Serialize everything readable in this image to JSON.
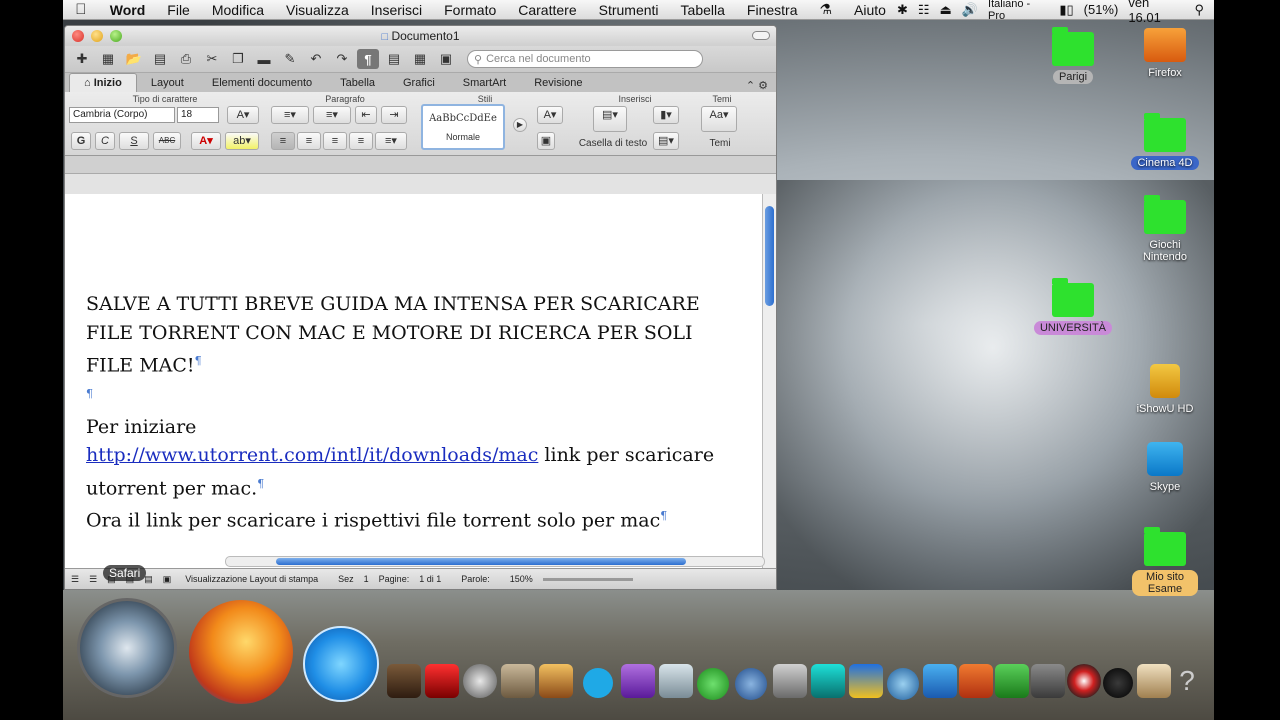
{
  "menubar": {
    "app": "Word",
    "items": [
      "File",
      "Modifica",
      "Visualizza",
      "Inserisci",
      "Formato",
      "Carattere",
      "Strumenti",
      "Tabella",
      "Finestra",
      "Aiuto"
    ],
    "input_source": "Italiano - Pro",
    "battery": "(51%)",
    "clock": "ven 16.01"
  },
  "window": {
    "title": "Documento1",
    "search_placeholder": "Cerca nel documento",
    "tabs": [
      "Inizio",
      "Layout",
      "Elementi documento",
      "Tabella",
      "Grafici",
      "SmartArt",
      "Revisione"
    ],
    "active_tab": "Inizio",
    "ribbon": {
      "font_group_title": "Tipo di carattere",
      "font_name": "Cambria (Corpo)",
      "font_size": "18",
      "paragraph_group_title": "Paragrafo",
      "styles_group_title": "Stili",
      "style_preview": "AaBbCcDdEe",
      "style_name": "Normale",
      "insert_group_title": "Inserisci",
      "textbox_label": "Casella di testo",
      "themes_group_title": "Temi",
      "themes_label": "Temi",
      "bold": "G",
      "italic": "C",
      "underline": "S",
      "strike": "ABC"
    },
    "document": {
      "line1": "SALVE A TUTTI BREVE GUIDA MA INTENSA PER SCARICARE FILE TORRENT CON MAC E MOTORE DI RICERCA PER SOLI FILE MAC!",
      "empty_mark": "¶",
      "line2": "Per iniziare",
      "link": "http://www.utorrent.com/intl/it/downloads/mac",
      "line3_rest": " link per scaricare utorrent per mac.",
      "line4": "Ora il link per scaricare i rispettivi file torrent solo per mac",
      "pilcrow": "¶"
    },
    "status": {
      "view": "Visualizzazione Layout di stampa",
      "sez_label": "Sez",
      "sez": "1",
      "pages_label": "Pagine:",
      "pages": "1 di 1",
      "words_label": "Parole:",
      "zoom": "150%"
    }
  },
  "desktop_icons": [
    {
      "label": "Parigi"
    },
    {
      "label": "Firefox"
    },
    {
      "label": "Cinema 4D"
    },
    {
      "label": "Giochi Nintendo"
    },
    {
      "label": "UNIVERSITÀ"
    },
    {
      "label": "iShowU HD"
    },
    {
      "label": "Skype"
    },
    {
      "label": "Mio sito Esame"
    }
  ],
  "dock": {
    "hover_label": "Safari"
  }
}
